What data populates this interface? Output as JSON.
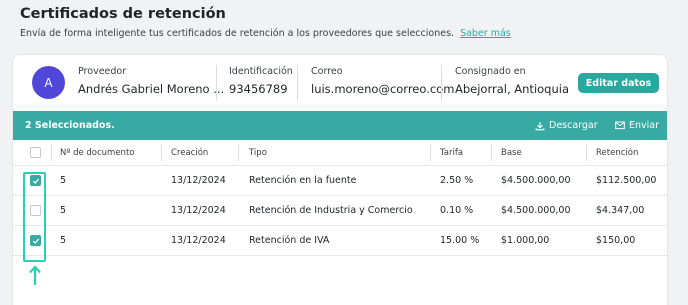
{
  "page": {
    "title": "Certificados de retención",
    "subtitle": "Envía de forma inteligente tus certificados de retención a los proveedores que selecciones.",
    "learn_more": "Saber más"
  },
  "provider": {
    "avatar_initial": "A",
    "proveedor_label": "Proveedor",
    "proveedor_value": "Andrés Gabriel Moreno ...",
    "id_label": "Identificación",
    "id_value": "93456789",
    "email_label": "Correo",
    "email_value": "luis.moreno@correo.com",
    "consignado_label": "Consignado en",
    "consignado_value": "Abejorral, Antioquia",
    "edit_button": "Editar datos"
  },
  "selection_bar": {
    "count_text": "2 Seleccionados.",
    "download_label": "Descargar",
    "send_label": "Enviar"
  },
  "table": {
    "headers": {
      "doc": "Nº de documento",
      "creacion": "Creación",
      "tipo": "Tipo",
      "tarifa": "Tarifa",
      "base": "Base",
      "retencion": "Retención"
    },
    "rows": [
      {
        "checked": true,
        "doc": "5",
        "creacion": "13/12/2024",
        "tipo": "Retención en la fuente",
        "tarifa": "2.50 %",
        "base": "$4.500.000,00",
        "retencion": "$112.500,00"
      },
      {
        "checked": false,
        "doc": "5",
        "creacion": "13/12/2024",
        "tipo": "Retención de Industria y Comercio",
        "tarifa": "0.10 %",
        "base": "$4.500.000,00",
        "retencion": "$4.347,00"
      },
      {
        "checked": true,
        "doc": "5",
        "creacion": "13/12/2024",
        "tipo": "Retención de IVA",
        "tarifa": "15.00 %",
        "base": "$1.000,00",
        "retencion": "$150,00"
      }
    ]
  },
  "colors": {
    "accent": "#36aaa3",
    "avatar": "#5046d8",
    "highlight": "#2ad0b4"
  }
}
